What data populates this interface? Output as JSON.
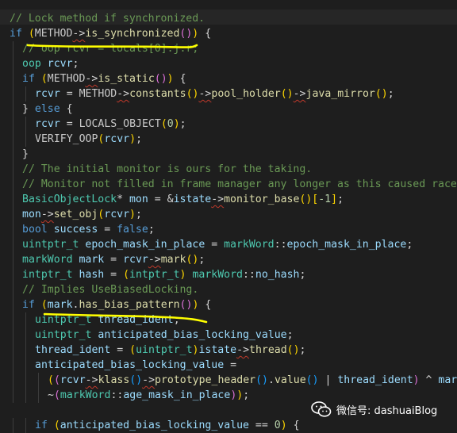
{
  "code_lines": [
    {
      "indent": 0,
      "tokens": [
        {
          "t": "// Lock method if synchronized.",
          "c": "cmt"
        }
      ]
    },
    {
      "indent": 0,
      "tokens": [
        {
          "t": "if ",
          "c": "kw"
        },
        {
          "t": "(",
          "c": "p1"
        },
        {
          "t": "METHOD",
          "c": "mac"
        },
        {
          "t": "->",
          "c": "op",
          "s": 1
        },
        {
          "t": "is_synchronized",
          "c": "fn"
        },
        {
          "t": "()",
          "c": "p2"
        },
        {
          "t": ")",
          "c": "p1"
        },
        {
          "t": " {",
          "c": "op"
        }
      ]
    },
    {
      "indent": 1,
      "tokens": [
        {
          "t": "// oop rcvr = locals[0].j.r;",
          "c": "cmt"
        }
      ]
    },
    {
      "indent": 1,
      "tokens": [
        {
          "t": "oop ",
          "c": "ty"
        },
        {
          "t": "rcvr",
          "c": "var"
        },
        {
          "t": ";",
          "c": "op"
        }
      ]
    },
    {
      "indent": 1,
      "tokens": [
        {
          "t": "if ",
          "c": "kw"
        },
        {
          "t": "(",
          "c": "p1"
        },
        {
          "t": "METHOD",
          "c": "mac"
        },
        {
          "t": "->",
          "c": "op",
          "s": 1
        },
        {
          "t": "is_static",
          "c": "fn"
        },
        {
          "t": "()",
          "c": "p2"
        },
        {
          "t": ")",
          "c": "p1"
        },
        {
          "t": " {",
          "c": "op"
        }
      ]
    },
    {
      "indent": 2,
      "tokens": [
        {
          "t": "rcvr",
          "c": "var"
        },
        {
          "t": " = ",
          "c": "op"
        },
        {
          "t": "METHOD",
          "c": "mac"
        },
        {
          "t": "->",
          "c": "op",
          "s": 1
        },
        {
          "t": "constants",
          "c": "fn"
        },
        {
          "t": "()",
          "c": "p1"
        },
        {
          "t": "->",
          "c": "op",
          "s": 1
        },
        {
          "t": "pool_holder",
          "c": "fn"
        },
        {
          "t": "()",
          "c": "p1"
        },
        {
          "t": "->",
          "c": "op",
          "s": 1
        },
        {
          "t": "java_mirror",
          "c": "fn"
        },
        {
          "t": "()",
          "c": "p1"
        },
        {
          "t": ";",
          "c": "op"
        }
      ]
    },
    {
      "indent": 1,
      "tokens": [
        {
          "t": "} ",
          "c": "op"
        },
        {
          "t": "else",
          "c": "kw"
        },
        {
          "t": " {",
          "c": "op"
        }
      ]
    },
    {
      "indent": 2,
      "tokens": [
        {
          "t": "rcvr",
          "c": "var"
        },
        {
          "t": " = ",
          "c": "op"
        },
        {
          "t": "LOCALS_OBJECT",
          "c": "mac"
        },
        {
          "t": "(",
          "c": "p1"
        },
        {
          "t": "0",
          "c": "num"
        },
        {
          "t": ")",
          "c": "p1"
        },
        {
          "t": ";",
          "c": "op"
        }
      ]
    },
    {
      "indent": 2,
      "tokens": [
        {
          "t": "VERIFY_OOP",
          "c": "mac"
        },
        {
          "t": "(",
          "c": "p1"
        },
        {
          "t": "rcvr",
          "c": "var"
        },
        {
          "t": ")",
          "c": "p1"
        },
        {
          "t": ";",
          "c": "op"
        }
      ]
    },
    {
      "indent": 1,
      "tokens": [
        {
          "t": "}",
          "c": "op"
        }
      ]
    },
    {
      "indent": 1,
      "tokens": [
        {
          "t": "// The initial monitor is ours for the taking.",
          "c": "cmt"
        }
      ]
    },
    {
      "indent": 1,
      "tokens": [
        {
          "t": "// Monitor not filled in frame manager any longer as this caused race",
          "c": "cmt"
        }
      ]
    },
    {
      "indent": 1,
      "tokens": [
        {
          "t": "BasicObjectLock",
          "c": "ty"
        },
        {
          "t": "* ",
          "c": "op"
        },
        {
          "t": "mon",
          "c": "var"
        },
        {
          "t": " = &",
          "c": "op"
        },
        {
          "t": "istate",
          "c": "var"
        },
        {
          "t": "->",
          "c": "op",
          "s": 1
        },
        {
          "t": "monitor_base",
          "c": "fn"
        },
        {
          "t": "()",
          "c": "p1"
        },
        {
          "t": "[",
          "c": "p1"
        },
        {
          "t": "-1",
          "c": "num"
        },
        {
          "t": "]",
          "c": "p1"
        },
        {
          "t": ";",
          "c": "op"
        }
      ]
    },
    {
      "indent": 1,
      "tokens": [
        {
          "t": "mon",
          "c": "var"
        },
        {
          "t": "->",
          "c": "op",
          "s": 1
        },
        {
          "t": "set_obj",
          "c": "fn"
        },
        {
          "t": "(",
          "c": "p1"
        },
        {
          "t": "rcvr",
          "c": "var"
        },
        {
          "t": ")",
          "c": "p1"
        },
        {
          "t": ";",
          "c": "op"
        }
      ]
    },
    {
      "indent": 1,
      "tokens": [
        {
          "t": "bool ",
          "c": "kw"
        },
        {
          "t": "success",
          "c": "var"
        },
        {
          "t": " = ",
          "c": "op"
        },
        {
          "t": "false",
          "c": "kw"
        },
        {
          "t": ";",
          "c": "op"
        }
      ]
    },
    {
      "indent": 1,
      "tokens": [
        {
          "t": "uintptr_t ",
          "c": "ty"
        },
        {
          "t": "epoch_mask_in_place",
          "c": "var"
        },
        {
          "t": " = ",
          "c": "op"
        },
        {
          "t": "markWord",
          "c": "ty"
        },
        {
          "t": "::",
          "c": "op"
        },
        {
          "t": "epoch_mask_in_place",
          "c": "var"
        },
        {
          "t": ";",
          "c": "op"
        }
      ]
    },
    {
      "indent": 1,
      "tokens": [
        {
          "t": "markWord ",
          "c": "ty"
        },
        {
          "t": "mark",
          "c": "var"
        },
        {
          "t": " = ",
          "c": "op"
        },
        {
          "t": "rcvr",
          "c": "var"
        },
        {
          "t": "->",
          "c": "op",
          "s": 1
        },
        {
          "t": "mark",
          "c": "fn"
        },
        {
          "t": "()",
          "c": "p1"
        },
        {
          "t": ";",
          "c": "op"
        }
      ]
    },
    {
      "indent": 1,
      "tokens": [
        {
          "t": "intptr_t ",
          "c": "ty"
        },
        {
          "t": "hash",
          "c": "var"
        },
        {
          "t": " = ",
          "c": "op"
        },
        {
          "t": "(",
          "c": "p1"
        },
        {
          "t": "intptr_t",
          "c": "ty"
        },
        {
          "t": ")",
          "c": "p1"
        },
        {
          "t": " ",
          "c": "op"
        },
        {
          "t": "markWord",
          "c": "ty"
        },
        {
          "t": "::",
          "c": "op"
        },
        {
          "t": "no_hash",
          "c": "var"
        },
        {
          "t": ";",
          "c": "op"
        }
      ]
    },
    {
      "indent": 1,
      "tokens": [
        {
          "t": "// Implies UseBiasedLocking.",
          "c": "cmt"
        }
      ]
    },
    {
      "indent": 1,
      "tokens": [
        {
          "t": "if ",
          "c": "kw"
        },
        {
          "t": "(",
          "c": "p1"
        },
        {
          "t": "mark",
          "c": "var"
        },
        {
          "t": ".",
          "c": "op"
        },
        {
          "t": "has_bias_pattern",
          "c": "fn"
        },
        {
          "t": "()",
          "c": "p2"
        },
        {
          "t": ")",
          "c": "p1"
        },
        {
          "t": " {",
          "c": "op"
        }
      ]
    },
    {
      "indent": 2,
      "tokens": [
        {
          "t": "uintptr_t ",
          "c": "ty"
        },
        {
          "t": "thread_ident",
          "c": "var"
        },
        {
          "t": ";",
          "c": "op"
        }
      ]
    },
    {
      "indent": 2,
      "tokens": [
        {
          "t": "uintptr_t ",
          "c": "ty"
        },
        {
          "t": "anticipated_bias_locking_value",
          "c": "var"
        },
        {
          "t": ";",
          "c": "op"
        }
      ]
    },
    {
      "indent": 2,
      "tokens": [
        {
          "t": "thread_ident",
          "c": "var"
        },
        {
          "t": " = ",
          "c": "op"
        },
        {
          "t": "(",
          "c": "p1"
        },
        {
          "t": "uintptr_t",
          "c": "ty"
        },
        {
          "t": ")",
          "c": "p1"
        },
        {
          "t": "istate",
          "c": "var"
        },
        {
          "t": "->",
          "c": "op",
          "s": 1
        },
        {
          "t": "thread",
          "c": "fn"
        },
        {
          "t": "()",
          "c": "p1"
        },
        {
          "t": ";",
          "c": "op"
        }
      ]
    },
    {
      "indent": 2,
      "tokens": [
        {
          "t": "anticipated_bias_locking_value",
          "c": "var"
        },
        {
          "t": " =",
          "c": "op"
        }
      ]
    },
    {
      "indent": 3,
      "tokens": [
        {
          "t": "(",
          "c": "p1"
        },
        {
          "t": "(",
          "c": "p2"
        },
        {
          "t": "rcvr",
          "c": "var"
        },
        {
          "t": "->",
          "c": "op",
          "s": 1
        },
        {
          "t": "klass",
          "c": "fn"
        },
        {
          "t": "()",
          "c": "p3"
        },
        {
          "t": "->",
          "c": "op",
          "s": 1
        },
        {
          "t": "prototype_header",
          "c": "fn"
        },
        {
          "t": "()",
          "c": "p3"
        },
        {
          "t": ".",
          "c": "op"
        },
        {
          "t": "value",
          "c": "fn"
        },
        {
          "t": "()",
          "c": "p3"
        },
        {
          "t": " | ",
          "c": "op"
        },
        {
          "t": "thread_ident",
          "c": "var"
        },
        {
          "t": ")",
          "c": "p2"
        },
        {
          "t": " ^ ",
          "c": "op"
        },
        {
          "t": "mar",
          "c": "var"
        }
      ]
    },
    {
      "indent": 3,
      "tokens": [
        {
          "t": "~",
          "c": "op"
        },
        {
          "t": "(",
          "c": "p2"
        },
        {
          "t": "markWord",
          "c": "ty"
        },
        {
          "t": "::",
          "c": "op"
        },
        {
          "t": "age_mask_in_place",
          "c": "var"
        },
        {
          "t": ")",
          "c": "p2"
        },
        {
          "t": ")",
          "c": "p1"
        },
        {
          "t": ";",
          "c": "op"
        }
      ]
    },
    {
      "indent": 0,
      "tokens": []
    },
    {
      "indent": 2,
      "tokens": [
        {
          "t": "if ",
          "c": "kw"
        },
        {
          "t": "(",
          "c": "p1"
        },
        {
          "t": "anticipated_bias_locking_value",
          "c": "var"
        },
        {
          "t": " == ",
          "c": "op"
        },
        {
          "t": "0",
          "c": "num"
        },
        {
          "t": ")",
          "c": "p1"
        },
        {
          "t": " {",
          "c": "op"
        }
      ]
    }
  ],
  "watermark": {
    "icon": "wechat-icon",
    "text": "微信号: dashuaiBlog"
  },
  "annotation": {
    "color": "#ffff00",
    "marks": [
      "underline-is-synchronized",
      "underline-has-bias-pattern"
    ]
  }
}
